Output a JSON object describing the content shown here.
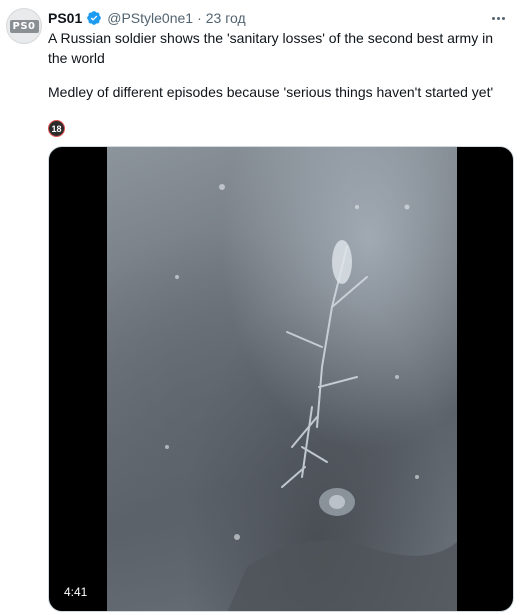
{
  "tweet": {
    "avatar_label": "PS0",
    "display_name": "PS01",
    "handle": "@PStyle0ne1",
    "separator": "·",
    "time": "23 год",
    "text_line_1": "A Russian soldier shows the 'sanitary losses' of the second best army in the world",
    "text_line_2": "Medley of different episodes because 'serious things haven't started yet'",
    "sensitive_badge": "18",
    "media": {
      "duration": "4:41"
    }
  },
  "colors": {
    "verified": "#1d9bf0",
    "secondary_text": "#536471",
    "primary_text": "#0f1419"
  },
  "icons": [
    "verified-icon",
    "more-icon",
    "age-restriction-icon"
  ]
}
